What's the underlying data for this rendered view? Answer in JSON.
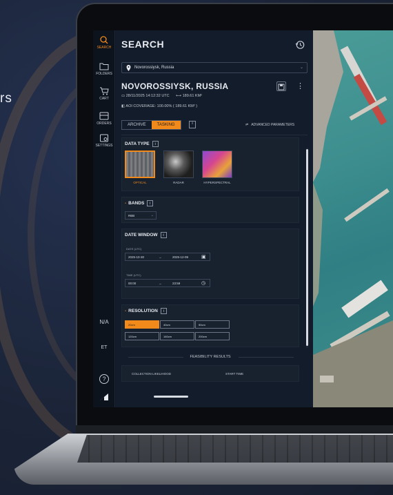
{
  "background_text": "rs",
  "nav": {
    "items": [
      {
        "label": "SEARCH",
        "icon": "search-icon",
        "active": true
      },
      {
        "label": "FOLDERS",
        "icon": "folder-icon"
      },
      {
        "label": "CART",
        "icon": "cart-icon"
      },
      {
        "label": "ORDERS",
        "icon": "orders-icon"
      },
      {
        "label": "SETTINGS",
        "icon": "settings-icon"
      }
    ],
    "na_label": "N/A",
    "et_label": "ET"
  },
  "panel": {
    "title": "SEARCH",
    "location_value": "Novorossiysk, Russia",
    "city_title": "NOVOROSSIYSK, RUSSIA",
    "datetime": "28/11/2025 14:12:32 UTC",
    "area": "189.61 KM²",
    "aoi_coverage": "AOI COVERAGE: 100.00% ( 189.61 KM² )",
    "tabs": [
      {
        "label": "ARCHIVE",
        "active": false
      },
      {
        "label": "TASKING",
        "active": true
      }
    ],
    "advanced_parameters": "ADVANCED PARAMETERS"
  },
  "data_type": {
    "title": "DATA TYPE",
    "options": [
      {
        "label": "OPTICAL",
        "selected": true
      },
      {
        "label": "RADAR",
        "selected": false
      },
      {
        "label": "HYPERSPECTRAL",
        "selected": false
      }
    ]
  },
  "bands": {
    "title": "BANDS",
    "value": "RBB"
  },
  "date_window": {
    "title": "DATE WINDOW",
    "dates_label": "DATE (UTC)",
    "date_from": "2025-10-30",
    "date_to": "2025-12-09",
    "time_label": "TIME (UTC)",
    "time_from": "00:00",
    "time_to": "23:59",
    "arrow": "→"
  },
  "resolution": {
    "title": "RESOLUTION",
    "options": [
      {
        "label": "20cm",
        "selected": true
      },
      {
        "label": "40cm",
        "selected": false
      },
      {
        "label": "50cm",
        "selected": false
      },
      {
        "label": "120cm",
        "selected": false
      },
      {
        "label": "160cm",
        "selected": false
      },
      {
        "label": "200cm",
        "selected": false
      }
    ]
  },
  "feasibility": {
    "title": "FEASIBILITY RESULTS",
    "col_likelihood": "COLLECTION LIKELIHOOD",
    "col_start": "START TIME"
  },
  "colors": {
    "accent": "#f28a1b",
    "panel_bg": "#131c2a",
    "rail_bg": "#0d131d",
    "page_bg": "#1b2437"
  }
}
